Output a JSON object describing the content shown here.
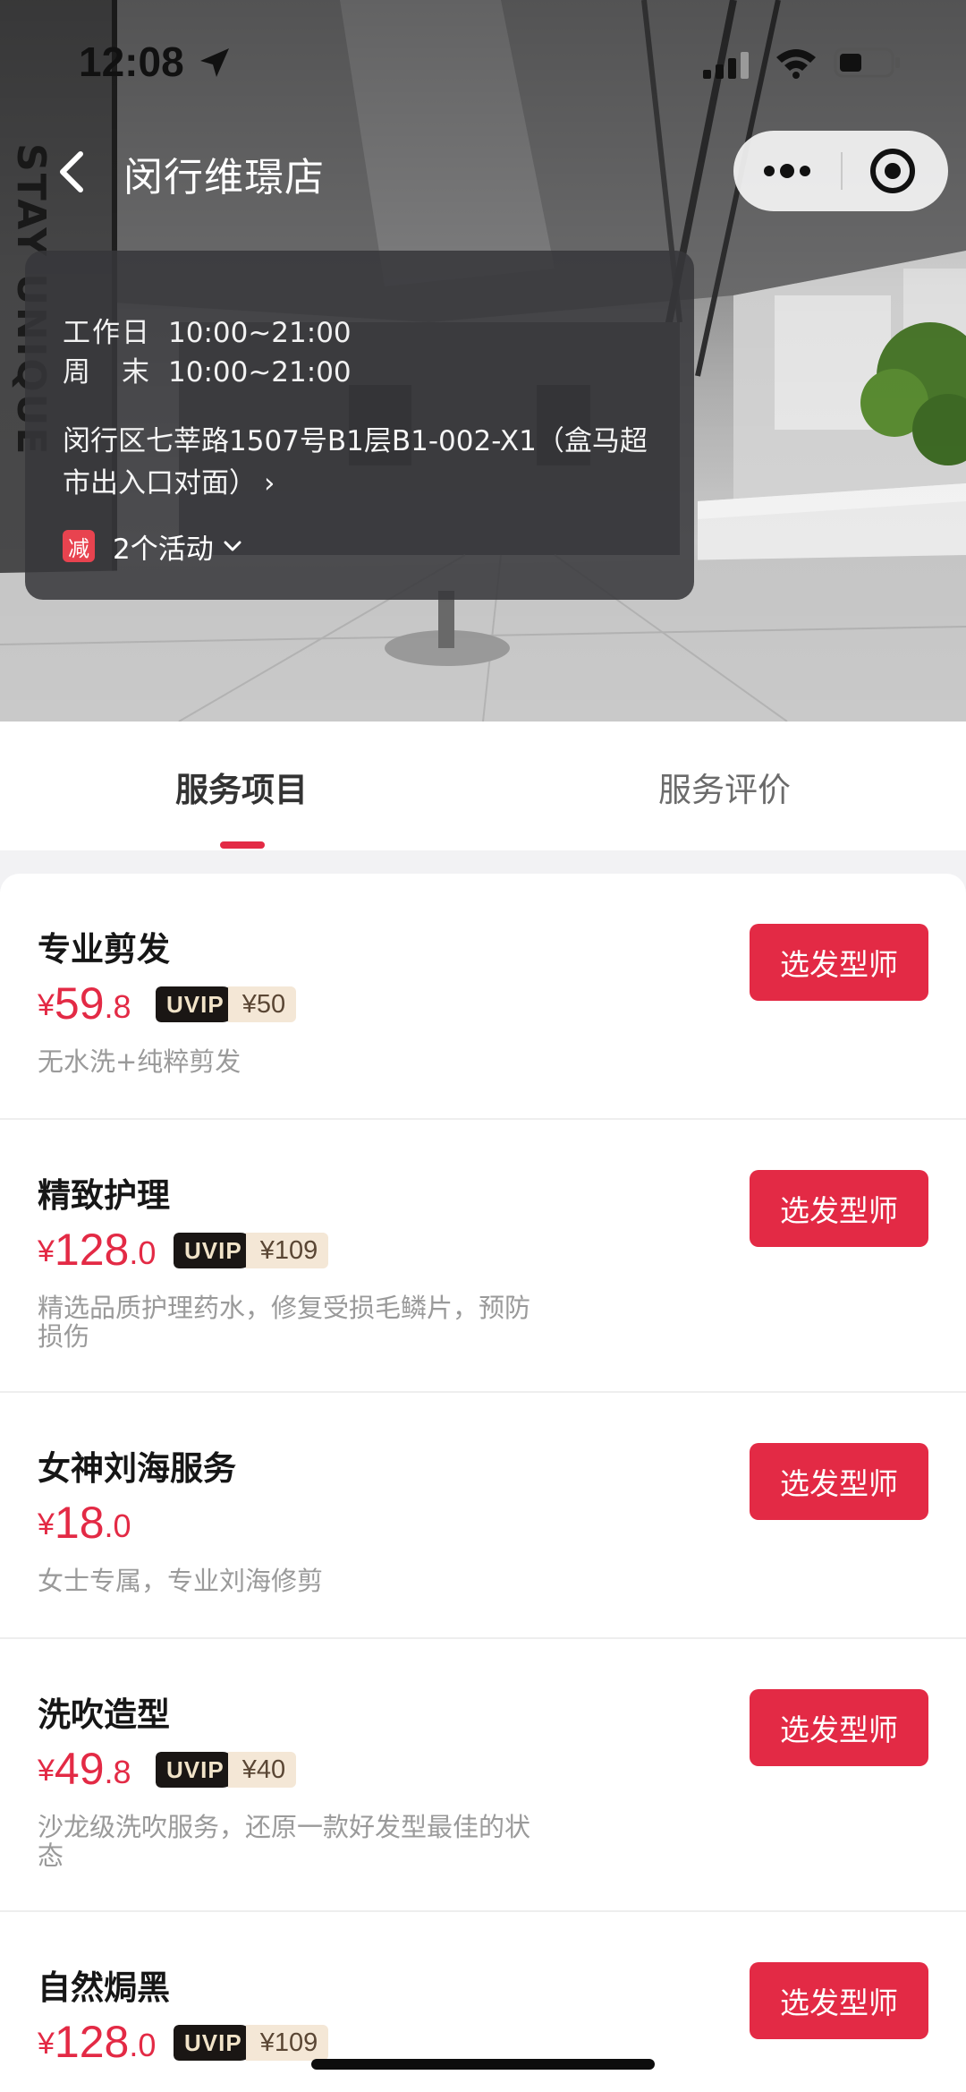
{
  "status_bar": {
    "time": "12:08",
    "icons": [
      "location-arrow-icon",
      "cellular-signal-icon",
      "wifi-icon",
      "battery-icon"
    ]
  },
  "nav": {
    "title": "闵行维璟店",
    "back_icon": "chevron-left-icon",
    "capsule_icons": [
      "more-dots-icon",
      "target-close-icon"
    ]
  },
  "store_info": {
    "hours": [
      {
        "label_a": "工作日",
        "label_b": "",
        "time": "10:00~21:00"
      },
      {
        "label_a": "周",
        "label_b": "末",
        "time": "10:00~21:00"
      }
    ],
    "address": "闵行区七莘路1507号B1层B1-002-X1（盒马超市出入口对面）",
    "address_chevron": "›",
    "promo_badge": "减",
    "promo_text": "2个活动",
    "promo_chevron_icon": "chevron-down-icon"
  },
  "tabs": [
    {
      "label": "服务项目",
      "active": true
    },
    {
      "label": "服务评价",
      "active": false
    }
  ],
  "services": [
    {
      "name": "专业剪发",
      "price_currency": "¥",
      "price_int": "59",
      "price_dec": ".8",
      "vip_tag": "UVIP",
      "vip_price": "¥50",
      "desc": "无水洗+纯粹剪发",
      "button": "选发型师"
    },
    {
      "name": "精致护理",
      "price_currency": "¥",
      "price_int": "128",
      "price_dec": ".0",
      "vip_tag": "UVIP",
      "vip_price": "¥109",
      "desc": "精选品质护理药水，修复受损毛鳞片，预防损伤",
      "button": "选发型师"
    },
    {
      "name": "女神刘海服务",
      "price_currency": "¥",
      "price_int": "18",
      "price_dec": ".0",
      "vip_tag": "",
      "vip_price": "",
      "desc": "女士专属，专业刘海修剪",
      "button": "选发型师"
    },
    {
      "name": "洗吹造型",
      "price_currency": "¥",
      "price_int": "49",
      "price_dec": ".8",
      "vip_tag": "UVIP",
      "vip_price": "¥40",
      "desc": "沙龙级洗吹服务，还原一款好发型最佳的状态",
      "button": "选发型师"
    },
    {
      "name": "自然焗黑",
      "price_currency": "¥",
      "price_int": "128",
      "price_dec": ".0",
      "vip_tag": "UVIP",
      "vip_price": "¥109",
      "desc": "",
      "button": "选发型师"
    }
  ],
  "colors": {
    "accent": "#e32a45",
    "vip_dark": "#1a1614",
    "vip_light": "#f4e7d6",
    "overlay": "#37373a"
  }
}
